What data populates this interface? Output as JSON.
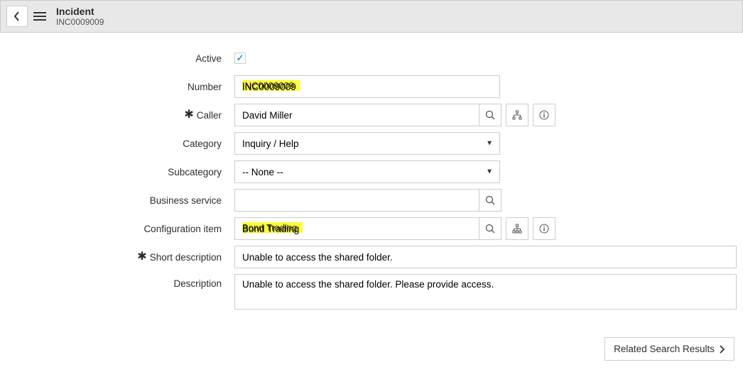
{
  "header": {
    "title": "Incident",
    "subtitle": "INC0009009"
  },
  "form": {
    "active": {
      "label": "Active",
      "checked": true
    },
    "number": {
      "label": "Number",
      "value": "INC0009009"
    },
    "caller": {
      "label": "Caller",
      "value": "David Miller"
    },
    "category": {
      "label": "Category",
      "value": "Inquiry / Help"
    },
    "subcategory": {
      "label": "Subcategory",
      "value": "-- None --"
    },
    "business_service": {
      "label": "Business service",
      "value": ""
    },
    "configuration_item": {
      "label": "Configuration item",
      "value": "Bond Trading"
    },
    "short_description": {
      "label": "Short description",
      "value": "Unable to access the shared folder."
    },
    "description": {
      "label": "Description",
      "value": "Unable to access the shared folder. Please provide access."
    }
  },
  "footer": {
    "related_results": "Related Search Results"
  }
}
